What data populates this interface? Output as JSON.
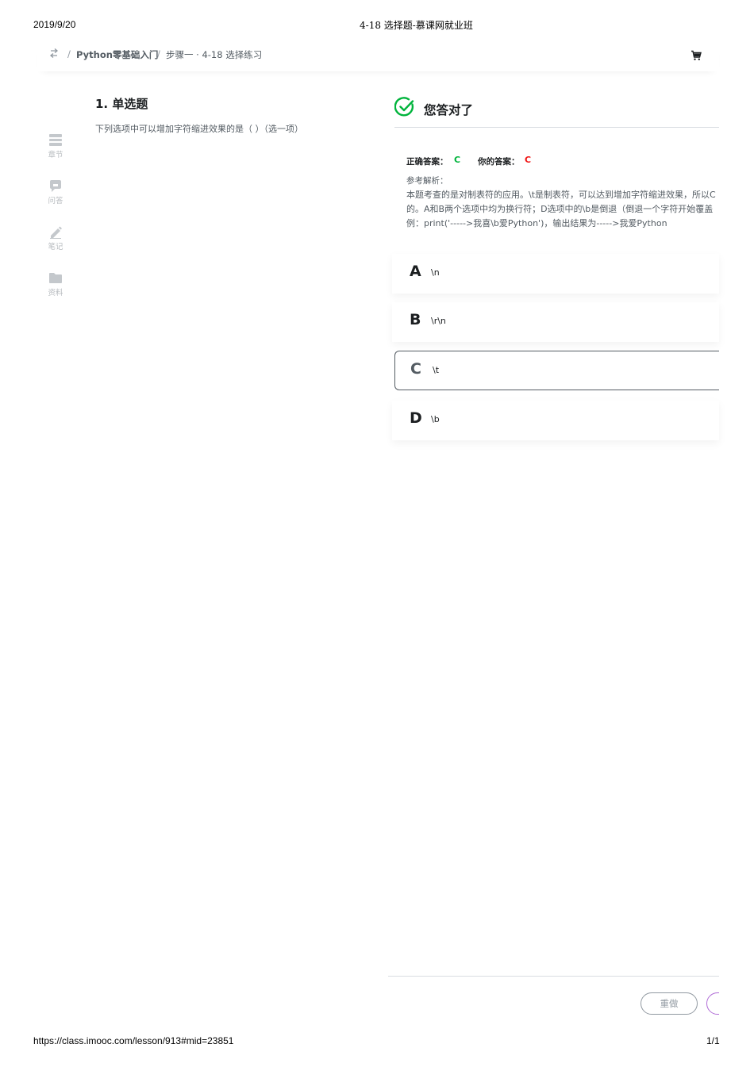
{
  "print_header": {
    "date": "2019/9/20",
    "title": "4-18 选择题-慕课网就业班"
  },
  "print_footer": {
    "url": "https://class.imooc.com/lesson/913#mid=23851",
    "page": "1/1"
  },
  "breadcrumb": {
    "back_icon": "swap-icon",
    "course": "Python零基础入门",
    "separator": "/",
    "current": "步骤一 · 4-18 选择练习"
  },
  "cart_icon": "cart-icon",
  "sidebar": {
    "items": [
      {
        "label": "章节",
        "icon": "chapters-icon"
      },
      {
        "label": "问答",
        "icon": "qa-icon"
      },
      {
        "label": "笔记",
        "icon": "pencil-icon"
      },
      {
        "label": "资料",
        "icon": "folder-icon"
      }
    ]
  },
  "question": {
    "title": "1. 单选题",
    "text": "下列选项中可以增加字符缩进效果的是（ ）（选一项）"
  },
  "result": {
    "title": "您答对了",
    "correct_label": "正确答案：",
    "correct_value": "C",
    "yours_label": "你的答案：",
    "yours_value": "C",
    "explanation_label": "参考解析：",
    "explanation_lines": [
      "本题考查的是对制表符的应用。\\t是制表符，可以达到增加字符缩进效果，所以C",
      "的。A和B两个选项中均为换行符；D选项中的\\b是倒退（倒退一个字符开始覆盖",
      "例：print('----->我喜\\b爱Python')，输出结果为----->我爱Python"
    ],
    "colors": {
      "check": "#00b43c",
      "correct": "#00b43c",
      "yours": "#f01414"
    }
  },
  "options": [
    {
      "letter": "A",
      "value": "\\n",
      "selected": false
    },
    {
      "letter": "B",
      "value": "\\r\\n",
      "selected": false
    },
    {
      "letter": "C",
      "value": "\\t",
      "selected": true
    },
    {
      "letter": "D",
      "value": "\\b",
      "selected": false
    }
  ],
  "footer": {
    "redo_label": "重做"
  }
}
